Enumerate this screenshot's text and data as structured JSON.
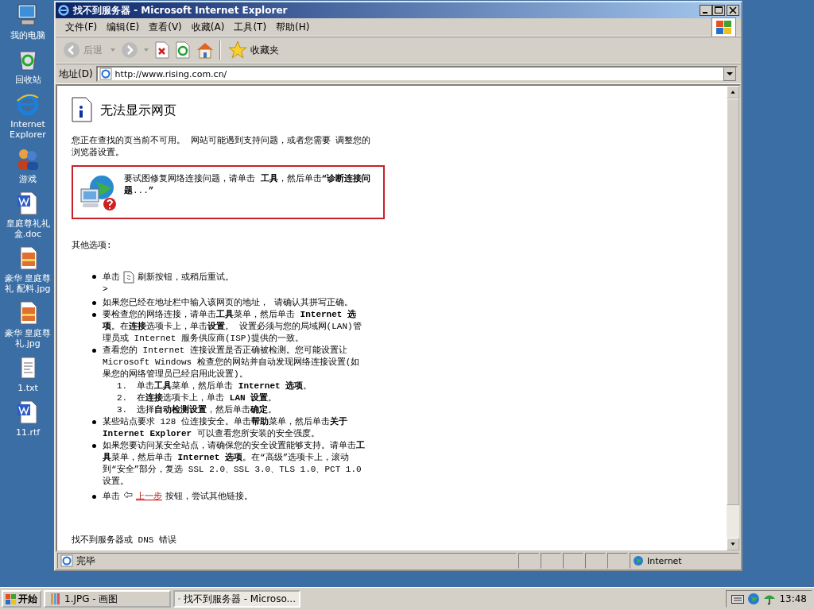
{
  "desktop_icons": [
    {
      "label": "我的电脑",
      "kind": "computer"
    },
    {
      "label": "回收站",
      "kind": "recycle"
    },
    {
      "label": "Internet Explorer",
      "kind": "ie"
    },
    {
      "label": "游戏",
      "kind": "people"
    },
    {
      "label": "皇庭尊礼礼盒.doc",
      "kind": "word"
    },
    {
      "label": "豪华 皇庭尊礼 配料.jpg",
      "kind": "image"
    },
    {
      "label": "豪华 皇庭尊礼.jpg",
      "kind": "image"
    },
    {
      "label": "1.txt",
      "kind": "text"
    },
    {
      "label": "11.rtf",
      "kind": "word"
    }
  ],
  "window": {
    "title": "找不到服务器 - Microsoft Internet Explorer"
  },
  "menu": [
    "文件(F)",
    "编辑(E)",
    "查看(V)",
    "收藏(A)",
    "工具(T)",
    "帮助(H)"
  ],
  "toolbar": {
    "back": "后退",
    "favorites": "收藏夹"
  },
  "address": {
    "label": "地址(D)",
    "value": "http://www.rising.com.cn/"
  },
  "page": {
    "heading": "无法显示网页",
    "intro": "您正在查找的页当前不可用。 网站可能遇到支持问题，或者您需要 调整您的浏览器设置。",
    "tip": "要试图修复网络连接问题，请单击 **工具**，然后单击**“诊断连接问题**...**”**",
    "options_title": "其他选项:",
    "options": [
      {
        "kind": "refresh",
        "before": "单击",
        "after": "刷新按钮，或稍后重试。",
        "extra": ">"
      },
      {
        "kind": "text",
        "text": "如果您已经在地址栏中输入该网页的地址， 请确认其拼写正确。"
      },
      {
        "kind": "text",
        "text": "要检查您的网络连接，请单击**工具**菜单，然后单击 **Internet 选项**。在**连接**选项卡上，单击**设置**。 设置必须与您的局域网(LAN)管理员或 Internet 服务供应商(ISP)提供的一致。"
      },
      {
        "kind": "steps",
        "text": "查看您的 Internet 连接设置是否正确被检测。您可能设置让 Microsoft Windows 检查您的网站并自动发现网络连接设置(如果您的网络管理员已经启用此设置)。",
        "steps": [
          {
            "number": "1.",
            "text": "单击**工具**菜单，然后单击 **Internet 选项**。"
          },
          {
            "number": "2.",
            "text": "在**连接**选项卡上，单击 **LAN 设置**。"
          },
          {
            "number": "3.",
            "text": "选择**自动检测设置**，然后单击**确定**。"
          }
        ]
      },
      {
        "kind": "text",
        "text": "某些站点要求 128 位连接安全。单击**帮助**菜单，然后单击**关于 Internet Explorer** 可以查看您所安装的安全强度。"
      },
      {
        "kind": "text",
        "text": "如果您要访问某安全站点，请确保您的安全设置能够支持。请单击**工具**菜单，然后单击 **Internet 选项**。在“高级”选项卡上，滚动到“安全”部分，复选 SSL 2.0、SSL 3.0、TLS 1.0、PCT 1.0 设置。"
      },
      {
        "kind": "back",
        "before": "单击",
        "link": "上一步",
        "after": "按钮，尝试其他链接。"
      }
    ],
    "footer": "找不到服务器或 DNS 错误"
  },
  "status_bar": {
    "text": "完毕",
    "zone": "Internet"
  },
  "taskbar": {
    "start": "开始",
    "tasks": [
      {
        "label": "1.JPG - 画图",
        "kind": "paint",
        "selected": false
      },
      {
        "label": "找不到服务器 - Microso...",
        "kind": "ie",
        "selected": true
      }
    ],
    "time": "13:48"
  }
}
